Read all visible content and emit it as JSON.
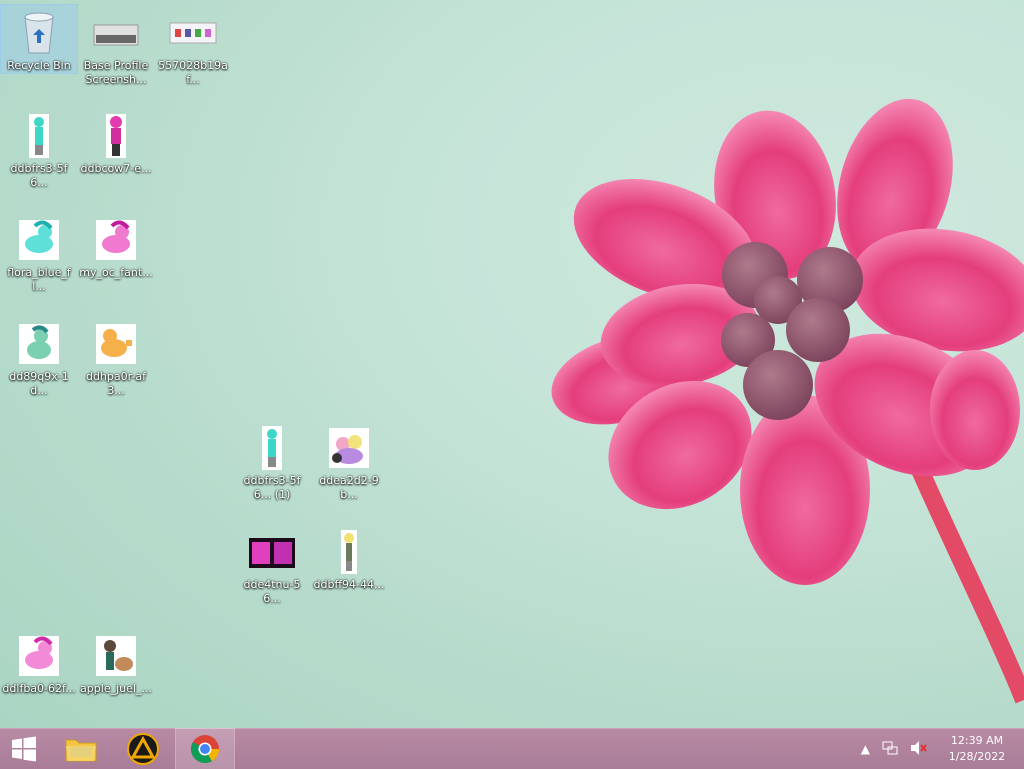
{
  "desktop": {
    "icons": [
      {
        "name": "recycle-bin",
        "label": "Recycle Bin",
        "selected": true
      },
      {
        "name": "base-profile-screenshot",
        "label": "Base Profile Screensh..."
      },
      {
        "name": "557028b19af",
        "label": "557028b19af..."
      },
      {
        "name": "ddbfrs3-5f6",
        "label": "ddbfrs3-5f6..."
      },
      {
        "name": "ddbcow7-e",
        "label": "ddbcow7-e..."
      },
      {
        "name": "flora-blue-fl",
        "label": "flora_blue_fl..."
      },
      {
        "name": "my-oc-fant",
        "label": "my_oc_fant..."
      },
      {
        "name": "dd89q9x-1d",
        "label": "dd89q9x-1d..."
      },
      {
        "name": "ddhpa0r-af3",
        "label": "ddhpa0r-af3..."
      },
      {
        "name": "ddbfrs3-5f6-1",
        "label": "ddbfrs3-5f6... (1)"
      },
      {
        "name": "ddea2d2-9b",
        "label": "ddea2d2-9b..."
      },
      {
        "name": "dde4tnu-56",
        "label": "dde4tnu-56..."
      },
      {
        "name": "ddbff94-44",
        "label": "ddbff94-44..."
      },
      {
        "name": "ddlfba0-62f",
        "label": "ddlfba0-62f..."
      },
      {
        "name": "apple-juel",
        "label": "apple_juel_..."
      }
    ]
  },
  "taskbar": {
    "start_icon": "windows-logo-icon",
    "apps": [
      {
        "name": "file-explorer",
        "icon": "folder-icon"
      },
      {
        "name": "vlc-like-app",
        "icon": "triangle-app-icon"
      },
      {
        "name": "chrome",
        "icon": "chrome-icon",
        "active": true
      }
    ],
    "tray": {
      "time": "12:39 AM",
      "date": "1/28/2022"
    }
  },
  "colors": {
    "taskbar": "#ab7f99",
    "wallpaper_bg": "#c2e2d5",
    "petal": "#e8407e"
  }
}
